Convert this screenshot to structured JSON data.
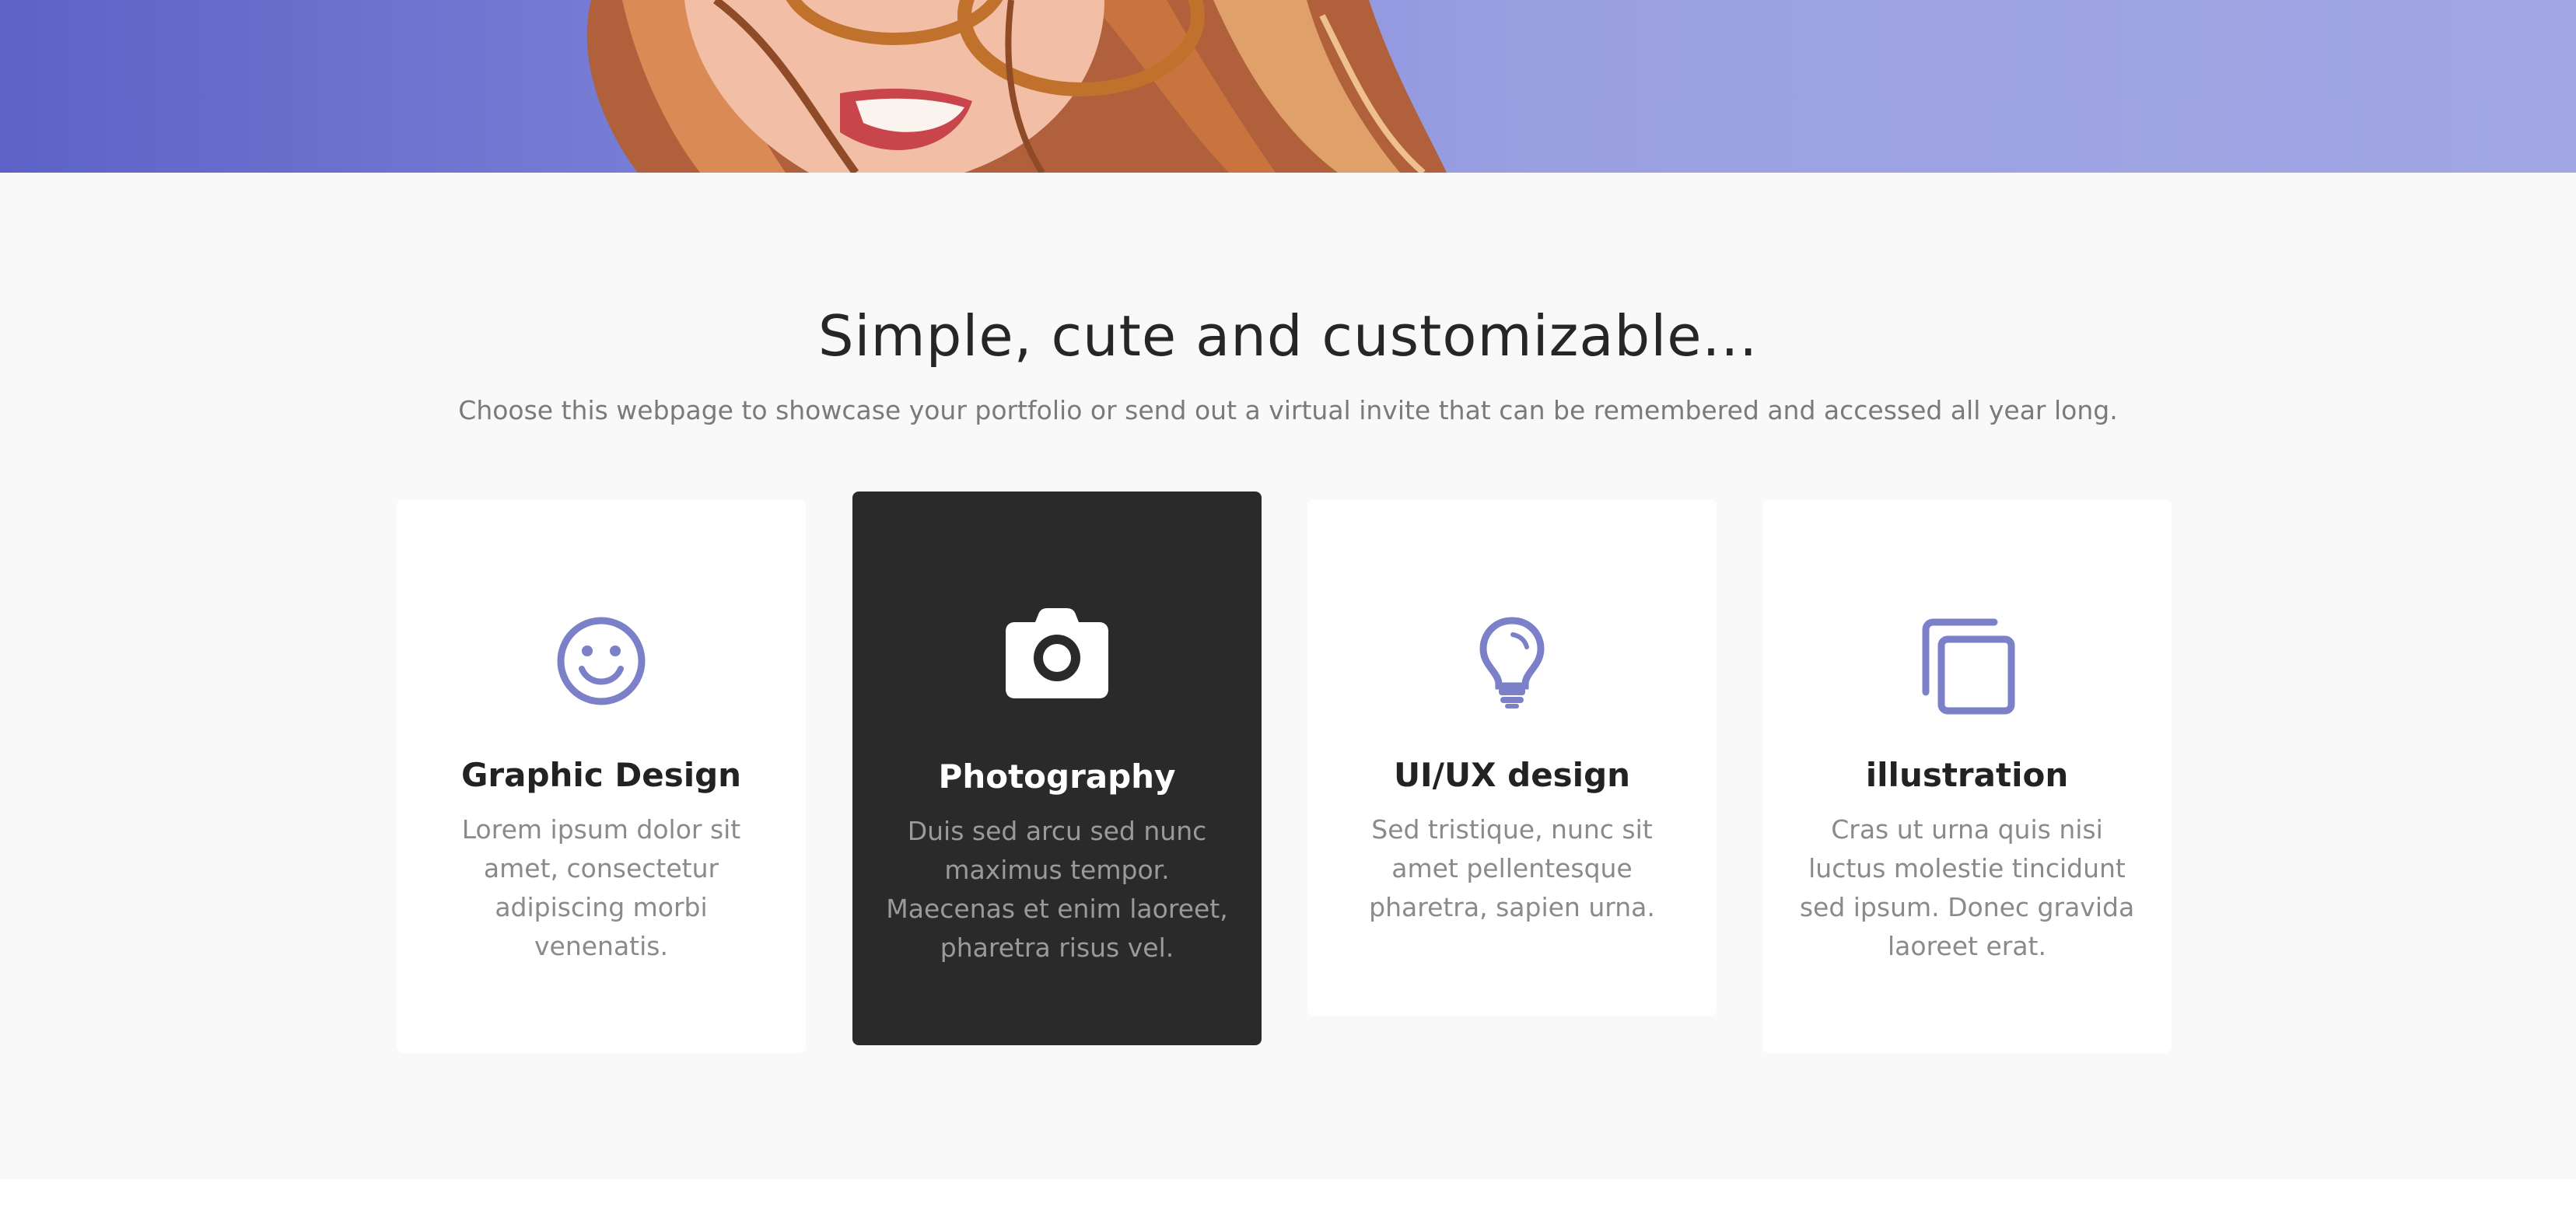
{
  "hero": {
    "background_colors": [
      "#5d62c6",
      "#9ba0e2"
    ]
  },
  "features": {
    "title": "Simple, cute and customizable...",
    "subtitle": "Choose this webpage to showcase your portfolio or send out a virtual invite that can be remembered and accessed all year long.",
    "accent_color": "#7b80c9",
    "cards": [
      {
        "icon": "smiley-icon",
        "title": "Graphic Design",
        "text": "Lorem ipsum dolor sit amet, consectetur adipiscing morbi venenatis.",
        "active": false
      },
      {
        "icon": "camera-icon",
        "title": "Photography",
        "text": "Duis sed arcu sed nunc maximus tempor. Maecenas et enim laoreet, pharetra risus vel.",
        "active": true
      },
      {
        "icon": "lightbulb-icon",
        "title": "UI/UX design",
        "text": "Sed tristique, nunc sit amet pellentesque pharetra, sapien urna.",
        "active": false
      },
      {
        "icon": "copy-icon",
        "title": "illustration",
        "text": "Cras ut urna quis nisi luctus molestie tincidunt sed ipsum. Donec gravida laoreet erat.",
        "active": false
      }
    ]
  }
}
